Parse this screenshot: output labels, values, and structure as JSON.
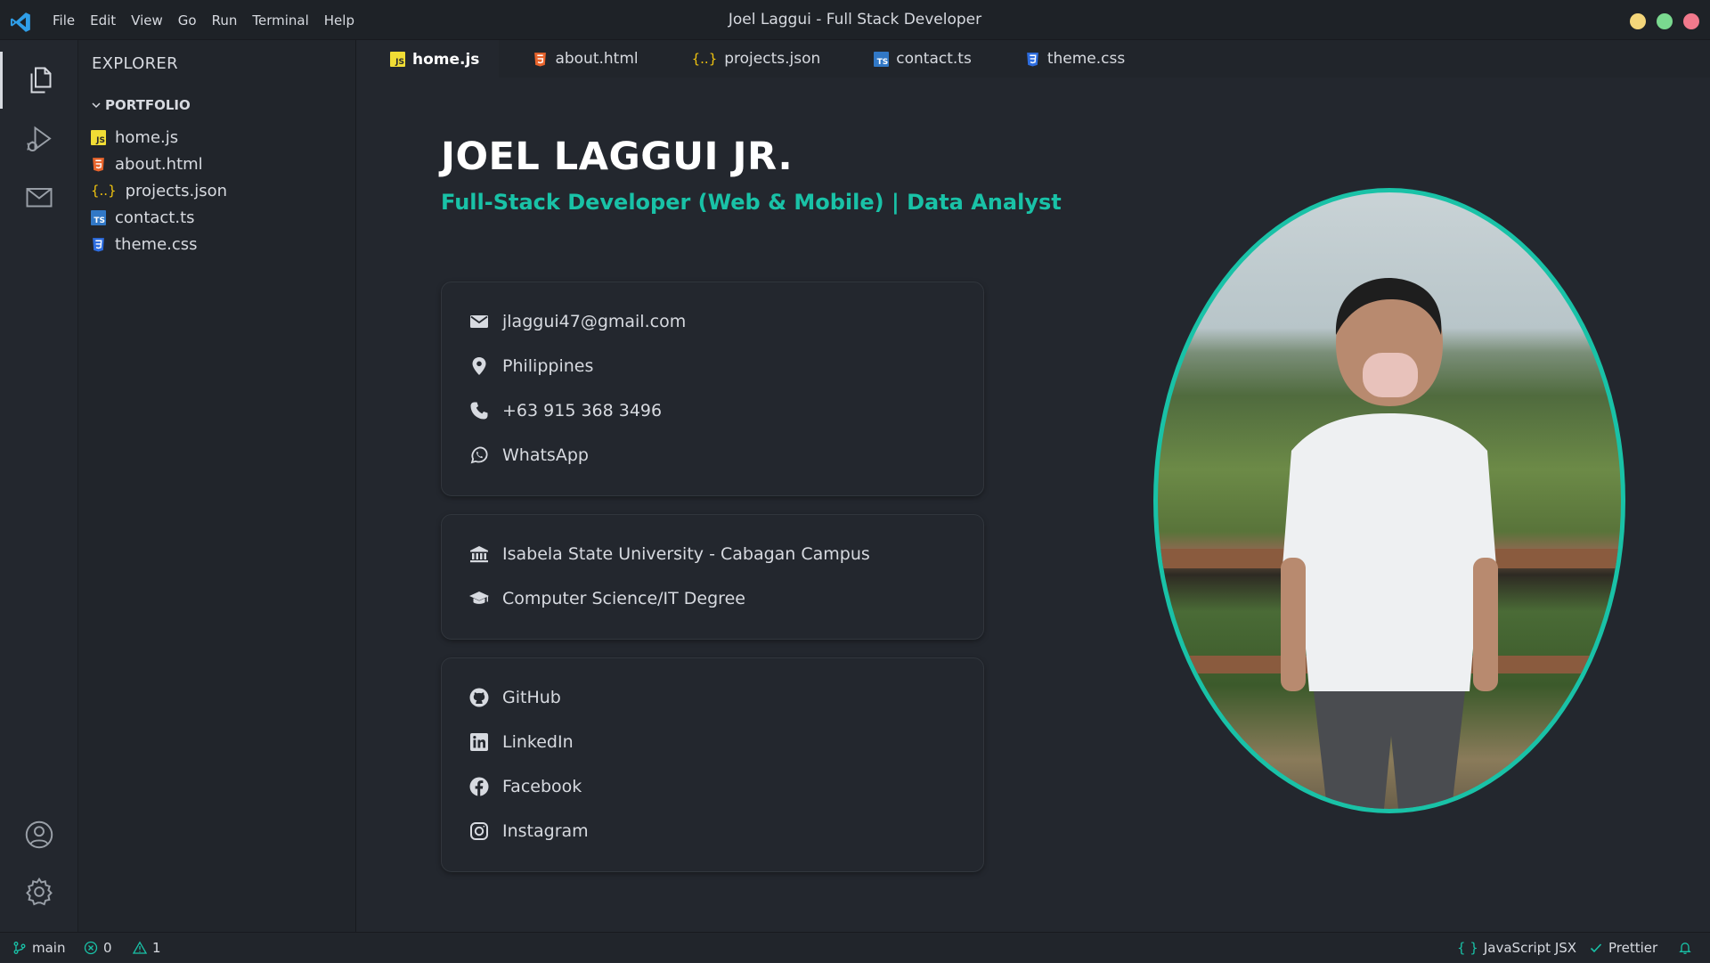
{
  "window": {
    "title": "Joel Laggui - Full Stack Developer",
    "menu": [
      "File",
      "Edit",
      "View",
      "Go",
      "Run",
      "Terminal",
      "Help"
    ],
    "traffic_colors": [
      "#f4d67a",
      "#7ad98f",
      "#f1798c"
    ]
  },
  "sidebar": {
    "header": "EXPLORER",
    "folder": "PORTFOLIO",
    "files": [
      {
        "name": "home.js",
        "icon": "js-file-icon"
      },
      {
        "name": "about.html",
        "icon": "html-file-icon"
      },
      {
        "name": "projects.json",
        "icon": "json-file-icon"
      },
      {
        "name": "contact.ts",
        "icon": "ts-file-icon"
      },
      {
        "name": "theme.css",
        "icon": "css-file-icon"
      }
    ]
  },
  "tabs": [
    {
      "label": "home.js",
      "active": true
    },
    {
      "label": "about.html",
      "active": false
    },
    {
      "label": "projects.json",
      "active": false
    },
    {
      "label": "contact.ts",
      "active": false
    },
    {
      "label": "theme.css",
      "active": false
    }
  ],
  "profile": {
    "name": "JOEL LAGGUI JR.",
    "role": "Full-Stack Developer (Web & Mobile) | Data Analyst",
    "accent_color": "#19c2a7",
    "contact": {
      "email": "jlaggui47@gmail.com",
      "location": "Philippines",
      "phone": "+63 915 368 3496",
      "whatsapp": "WhatsApp"
    },
    "education": {
      "school": "Isabela State University - Cabagan Campus",
      "degree": "Computer Science/IT Degree"
    },
    "social": {
      "github": "GitHub",
      "linkedin": "LinkedIn",
      "facebook": "Facebook",
      "instagram": "Instagram"
    }
  },
  "statusbar": {
    "branch": "main",
    "errors": "0",
    "warnings": "1",
    "language": "JavaScript JSX",
    "formatter": "Prettier"
  }
}
